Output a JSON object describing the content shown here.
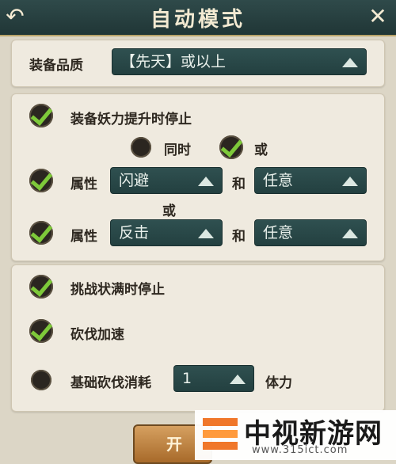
{
  "header": {
    "title": "自动模式",
    "back_glyph": "↶",
    "close_glyph": "✕"
  },
  "quality": {
    "label": "装备品质",
    "value": "【先天】或以上"
  },
  "stop_rules": {
    "monster_power": {
      "label": "装备妖力提升时停止",
      "checked": true
    },
    "mode_same": {
      "label": "同时",
      "checked": false
    },
    "mode_or": {
      "label": "或",
      "checked": true
    },
    "attr1": {
      "label": "属性",
      "value1": "闪避",
      "join": "和",
      "value2": "任意",
      "checked": true
    },
    "or_label": "或",
    "attr2": {
      "label": "属性",
      "value1": "反击",
      "join": "和",
      "value2": "任意",
      "checked": true
    }
  },
  "other": {
    "challenge_full": {
      "label": "挑战状满时停止",
      "checked": true
    },
    "chop_speed": {
      "label": "砍伐加速",
      "checked": true
    },
    "chop_cost": {
      "label": "基础砍伐消耗",
      "value": "1",
      "unit": "体力",
      "checked": false
    }
  },
  "start_button": {
    "label": "开"
  },
  "watermark": {
    "name": "中视新游网",
    "url": "www.315ict.com"
  }
}
